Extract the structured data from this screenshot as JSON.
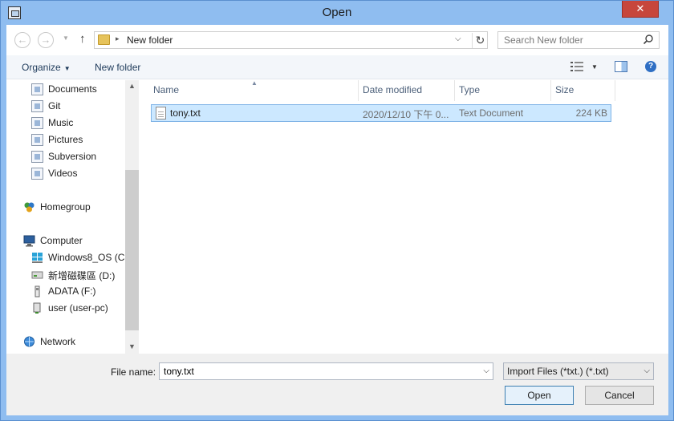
{
  "window": {
    "title": "Open",
    "close_glyph": "✕"
  },
  "address": {
    "crumbs": [
      "New folder"
    ],
    "separator": "▸",
    "search_placeholder": "Search New folder"
  },
  "toolbar": {
    "organize_label": "Organize",
    "new_folder_label": "New folder",
    "help_glyph": "?"
  },
  "navigation": {
    "libraries": [
      {
        "label": "Documents",
        "icon": "documents-library-icon"
      },
      {
        "label": "Git",
        "icon": "git-library-icon"
      },
      {
        "label": "Music",
        "icon": "music-library-icon"
      },
      {
        "label": "Pictures",
        "icon": "pictures-library-icon"
      },
      {
        "label": "Subversion",
        "icon": "subversion-library-icon"
      },
      {
        "label": "Videos",
        "icon": "videos-library-icon"
      }
    ],
    "homegroup": "Homegroup",
    "computer": "Computer",
    "drives": [
      {
        "label": "Windows8_OS (C:",
        "icon": "windows-drive-icon"
      },
      {
        "label": "新增磁碟區 (D:)",
        "icon": "hard-drive-icon"
      },
      {
        "label": "ADATA (F:)",
        "icon": "usb-drive-icon"
      },
      {
        "label": "user (user-pc)",
        "icon": "network-drive-icon"
      }
    ],
    "network": "Network"
  },
  "file_list": {
    "columns": [
      "Name",
      "Date modified",
      "Type",
      "Size"
    ],
    "rows": [
      {
        "name": "tony.txt",
        "date_modified": "2020/12/10 下午 0...",
        "type": "Text Document",
        "size": "224 KB",
        "selected": true
      }
    ]
  },
  "bottom": {
    "file_name_label": "File name:",
    "file_name_value": "tony.txt",
    "filter_value": "Import Files (*txt.) (*.txt)",
    "open_label": "Open",
    "cancel_label": "Cancel"
  },
  "colors": {
    "selection_bg": "#cce8ff",
    "selection_border": "#7fb3e6",
    "title_bar": "#8fbdf0",
    "close_button": "#c7463c"
  }
}
